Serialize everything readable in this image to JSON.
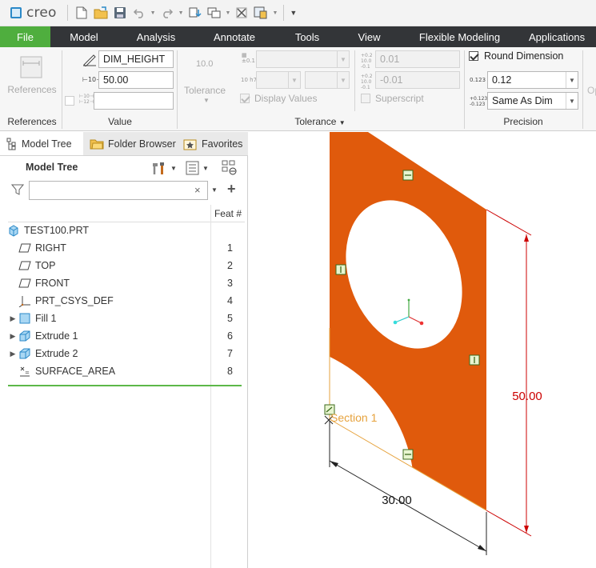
{
  "app": {
    "name": "creo"
  },
  "menu": [
    {
      "label": "File",
      "active": true
    },
    {
      "label": "Model"
    },
    {
      "label": "Analysis"
    },
    {
      "label": "Annotate"
    },
    {
      "label": "Tools"
    },
    {
      "label": "View"
    },
    {
      "label": "Flexible Modeling"
    },
    {
      "label": "Applications"
    }
  ],
  "ribbon": {
    "references": {
      "button_label": "References",
      "group_label": "References"
    },
    "value": {
      "name_field": "DIM_HEIGHT",
      "value_field": "50.00",
      "third_field": "",
      "group_label": "Value"
    },
    "tolerance": {
      "icon_value": "10.0",
      "button_label": "Tolerance",
      "upper_limit": "0.01",
      "lower_limit": "-0.01",
      "display_values_label": "Display Values",
      "display_values_checked": true,
      "superscript_label": "Superscript",
      "superscript_checked": false,
      "group_label": "Tolerance",
      "tiny_plus": "±0.1",
      "tiny_fit": "10 h7",
      "tiny_up": "10+0.2",
      "tiny_dn": "-0.1"
    },
    "precision": {
      "round_dimension_label": "Round Dimension",
      "round_dimension_checked": true,
      "decimals": "0.12",
      "tolerance_decimals": "Same As Dim",
      "group_label": "Precision",
      "icon_a": "0.123",
      "icon_b": "+0.123"
    },
    "cut_label": "Op"
  },
  "left_panel": {
    "tabs": [
      {
        "label": "Model Tree",
        "icon": "model-tree-icon",
        "active": true
      },
      {
        "label": "Folder Browser",
        "icon": "folder-icon"
      },
      {
        "label": "Favorites",
        "icon": "favorites-icon"
      }
    ],
    "tree_title": "Model Tree",
    "search_placeholder": "",
    "feat_column": "Feat #",
    "root": {
      "name": "TEST100.PRT",
      "icon": "part-icon"
    },
    "items": [
      {
        "name": "RIGHT",
        "num": "1",
        "icon": "datum-plane-icon",
        "expandable": false
      },
      {
        "name": "TOP",
        "num": "2",
        "icon": "datum-plane-icon",
        "expandable": false
      },
      {
        "name": "FRONT",
        "num": "3",
        "icon": "datum-plane-icon",
        "expandable": false
      },
      {
        "name": "PRT_CSYS_DEF",
        "num": "4",
        "icon": "csys-icon",
        "expandable": false
      },
      {
        "name": "Fill 1",
        "num": "5",
        "icon": "fill-icon",
        "expandable": true
      },
      {
        "name": "Extrude 1",
        "num": "6",
        "icon": "extrude-icon",
        "expandable": true
      },
      {
        "name": "Extrude 2",
        "num": "7",
        "icon": "extrude-icon",
        "expandable": true
      },
      {
        "name": "SURFACE_AREA",
        "num": "8",
        "icon": "analysis-icon",
        "expandable": false
      }
    ]
  },
  "graphics": {
    "dim_height": "50.00",
    "dim_width": "30.00",
    "section_label": "Section 1",
    "colors": {
      "surface": "#e05a0c",
      "dimension": "#cc0000",
      "edge": "#e6a23c"
    }
  }
}
